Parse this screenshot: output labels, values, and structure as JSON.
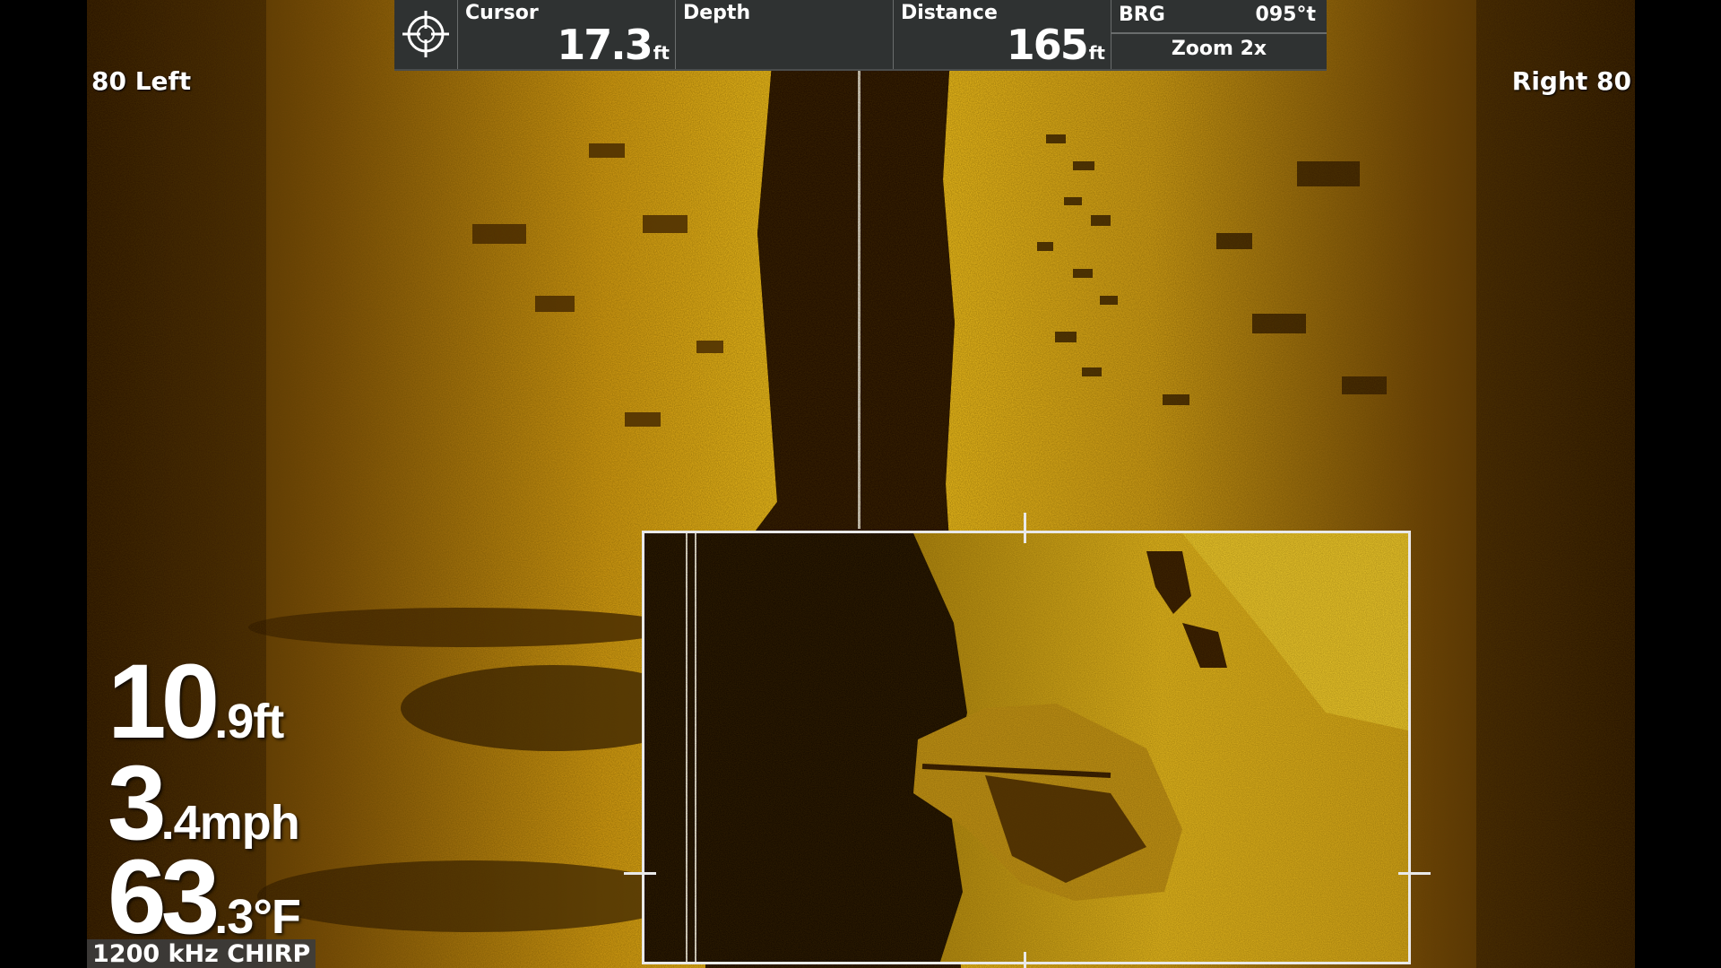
{
  "top_bar": {
    "cursor": {
      "label": "Cursor",
      "value": "17.3",
      "unit": "ft"
    },
    "depth": {
      "label": "Depth",
      "value": "",
      "unit": ""
    },
    "distance": {
      "label": "Distance",
      "value": "165",
      "unit": "ft"
    },
    "bearing": {
      "label": "BRG",
      "value": "095°t"
    },
    "zoom": {
      "label": "Zoom 2x"
    }
  },
  "range": {
    "left": "80 Left",
    "right": "Right 80"
  },
  "readouts": {
    "depth": {
      "whole": "10",
      "fraction": ".9",
      "unit": "ft"
    },
    "speed": {
      "whole": "3",
      "fraction": ".4",
      "unit": "mph"
    },
    "temperature": {
      "whole": "63",
      "fraction": ".3",
      "unit": "°F"
    }
  },
  "frequency": "1200 kHz CHIRP",
  "colors": {
    "sonar_bright": "#f2c21a",
    "sonar_mid": "#b88010",
    "sonar_dark": "#2a1400",
    "bar_bg": "#2f3232",
    "text": "#ffffff"
  },
  "icons": {
    "cursor": "crosshair-icon"
  }
}
